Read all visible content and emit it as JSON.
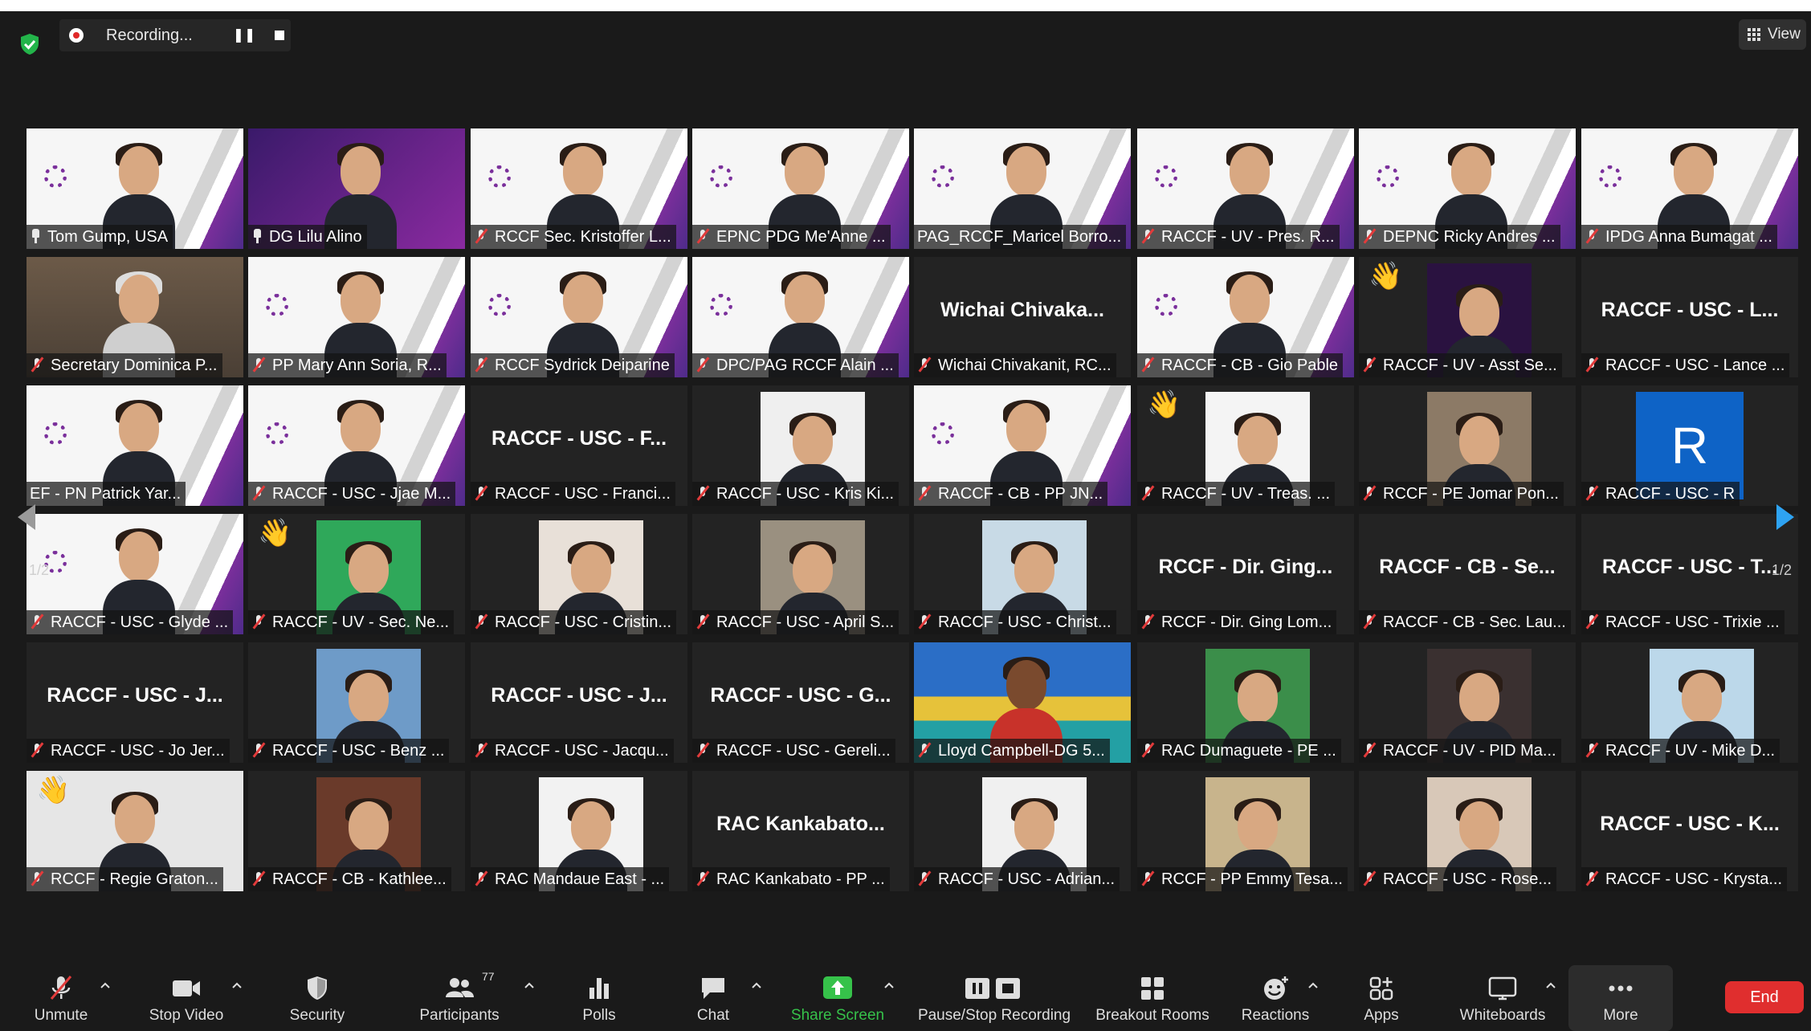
{
  "topbar": {
    "recording_label": "Recording...",
    "view_label": "View"
  },
  "paging": {
    "left_count": "1/2",
    "right_count": "1/2"
  },
  "tiles": [
    {
      "name": "Tom Gump, USA",
      "kind": "rotary",
      "icon": "pin-icon"
    },
    {
      "name": "DG Lilu Alino",
      "kind": "purple",
      "icon": "pin-icon"
    },
    {
      "name": "RCCF Sec. Kristoffer L...",
      "kind": "rotary",
      "icon": "mic-off-icon"
    },
    {
      "name": "EPNC PDG Me'Anne ...",
      "kind": "rotary",
      "icon": "mic-off-icon"
    },
    {
      "name": "PAG_RCCF_Maricel Borro...",
      "kind": "rotary",
      "icon": "none",
      "active": true
    },
    {
      "name": "RACCF - UV - Pres. R...",
      "kind": "rotary",
      "icon": "mic-off-icon"
    },
    {
      "name": "DEPNC Ricky Andres ...",
      "kind": "rotary",
      "icon": "mic-off-icon"
    },
    {
      "name": "IPDG Anna Bumagat ...",
      "kind": "rotary",
      "icon": "mic-off-icon"
    },
    {
      "name": "Secretary Dominica P...",
      "kind": "room",
      "icon": "mic-off-icon"
    },
    {
      "name": "PP Mary Ann Soria, R...",
      "kind": "rotary",
      "icon": "mic-off-icon"
    },
    {
      "name": "RCCF Sydrick Deiparine",
      "kind": "rotary",
      "icon": "mic-off-icon"
    },
    {
      "name": "DPC/PAG RCCF Alain ...",
      "kind": "rotary",
      "icon": "mic-off-icon"
    },
    {
      "name": "Wichai Chivakanit, RC...",
      "kind": "text",
      "big": "Wichai  Chivaka...",
      "icon": "mic-off-icon"
    },
    {
      "name": "RACCF - CB - Gio Pable",
      "kind": "rotary",
      "icon": "mic-off-icon"
    },
    {
      "name": "RACCF - UV - Asst Se...",
      "kind": "photo",
      "photo": "#2a1240",
      "icon": "mic-off-icon",
      "hand": true
    },
    {
      "name": "RACCF - USC - Lance ...",
      "kind": "text",
      "big": "RACCF - USC - L...",
      "icon": "mic-off-icon"
    },
    {
      "name": "EF - PN Patrick Yar...",
      "kind": "rotary",
      "icon": "none"
    },
    {
      "name": "RACCF - USC - Jjae M...",
      "kind": "rotary",
      "icon": "mic-off-icon"
    },
    {
      "name": "RACCF - USC - Franci...",
      "kind": "text",
      "big": "RACCF - USC - F...",
      "icon": "mic-off-icon"
    },
    {
      "name": "RACCF - USC - Kris Ki...",
      "kind": "photo",
      "photo": "#efefef",
      "icon": "mic-off-icon"
    },
    {
      "name": "RACCF - CB - PP JN...",
      "kind": "rotary",
      "icon": "mic-off-icon"
    },
    {
      "name": "RACCF - UV - Treas. ...",
      "kind": "photo",
      "photo": "#f4f4f4",
      "icon": "mic-off-icon",
      "hand": true
    },
    {
      "name": "RCCF - PE Jomar Pon...",
      "kind": "photo",
      "photo": "#8c7a66",
      "icon": "mic-off-icon"
    },
    {
      "name": "RACCF - USC - R",
      "kind": "initial",
      "initial": "R",
      "icon": "mic-off-icon"
    },
    {
      "name": "RACCF - USC - Glyde ...",
      "kind": "rotary",
      "icon": "mic-off-icon"
    },
    {
      "name": "RACCF - UV - Sec. Ne...",
      "kind": "photo",
      "photo": "#2fa85a",
      "icon": "mic-off-icon",
      "hand": true
    },
    {
      "name": "RACCF - USC - Cristin...",
      "kind": "photo",
      "photo": "#e8e0d8",
      "icon": "mic-off-icon"
    },
    {
      "name": "RACCF - USC - April S...",
      "kind": "photo",
      "photo": "#9a9080",
      "icon": "mic-off-icon"
    },
    {
      "name": "RACCF - USC - Christ...",
      "kind": "photo",
      "photo": "#c8dae6",
      "icon": "mic-off-icon"
    },
    {
      "name": "RCCF - Dir. Ging Lom...",
      "kind": "text",
      "big": "RCCF - Dir. Ging...",
      "icon": "mic-off-icon"
    },
    {
      "name": "RACCF - CB - Sec. Lau...",
      "kind": "text",
      "big": "RACCF - CB - Se...",
      "icon": "mic-off-icon"
    },
    {
      "name": "RACCF - USC - Trixie ...",
      "kind": "text",
      "big": "RACCF - USC - T...",
      "icon": "mic-off-icon"
    },
    {
      "name": "RACCF - USC - Jo Jer...",
      "kind": "text",
      "big": "RACCF - USC - J...",
      "icon": "mic-off-icon"
    },
    {
      "name": "RACCF - USC - Benz ...",
      "kind": "photo",
      "photo": "#6e9bc8",
      "icon": "mic-off-icon"
    },
    {
      "name": "RACCF - USC - Jacqu...",
      "kind": "text",
      "big": "RACCF - USC - J...",
      "icon": "mic-off-icon"
    },
    {
      "name": "RACCF - USC - Gereli...",
      "kind": "text",
      "big": "RACCF - USC - G...",
      "icon": "mic-off-icon"
    },
    {
      "name": "Lloyd Campbell-DG 5...",
      "kind": "blue",
      "icon": "mic-off-icon"
    },
    {
      "name": "RAC Dumaguete - PE ...",
      "kind": "photo",
      "photo": "#3b8e4a",
      "icon": "mic-off-icon"
    },
    {
      "name": "RACCF - UV - PID Ma...",
      "kind": "photo",
      "photo": "#3a3030",
      "icon": "mic-off-icon"
    },
    {
      "name": "RACCF - UV - Mike D...",
      "kind": "photo",
      "photo": "#bcd8ea",
      "icon": "mic-off-icon"
    },
    {
      "name": "RCCF - Regie Graton...",
      "kind": "photo-full",
      "photo": "#e6e6e6",
      "icon": "mic-off-icon",
      "hand": true
    },
    {
      "name": "RACCF - CB - Kathlee...",
      "kind": "photo",
      "photo": "#6a3a2a",
      "icon": "mic-off-icon"
    },
    {
      "name": "RAC Mandaue East - ...",
      "kind": "photo",
      "photo": "#f2f2f2",
      "icon": "mic-off-icon"
    },
    {
      "name": "RAC Kankabato - PP ...",
      "kind": "text",
      "big": "RAC Kankabato...",
      "icon": "mic-off-icon"
    },
    {
      "name": "RACCF - USC - Adrian...",
      "kind": "photo",
      "photo": "#f0f0f0",
      "icon": "mic-off-icon"
    },
    {
      "name": "RCCF - PP Emmy Tesa...",
      "kind": "photo",
      "photo": "#c8b48c",
      "icon": "mic-off-icon"
    },
    {
      "name": "RACCF - USC - Rose...",
      "kind": "photo",
      "photo": "#d8c8b8",
      "icon": "mic-off-icon"
    },
    {
      "name": "RACCF - USC - Krysta...",
      "kind": "text",
      "big": "RACCF - USC - K...",
      "icon": "mic-off-icon"
    }
  ],
  "toolbar": {
    "unmute": "Unmute",
    "stop_video": "Stop Video",
    "security": "Security",
    "participants": "Participants",
    "participants_count": "77",
    "polls": "Polls",
    "chat": "Chat",
    "share_screen": "Share Screen",
    "pause_recording": "Pause/Stop Recording",
    "breakout_rooms": "Breakout Rooms",
    "reactions": "Reactions",
    "apps": "Apps",
    "whiteboards": "Whiteboards",
    "more": "More",
    "end": "End"
  },
  "colors": {
    "background": "#1a1a1a",
    "share_green": "#36c24a",
    "end_red": "#e02e2e",
    "active_border": "#d2d552"
  }
}
